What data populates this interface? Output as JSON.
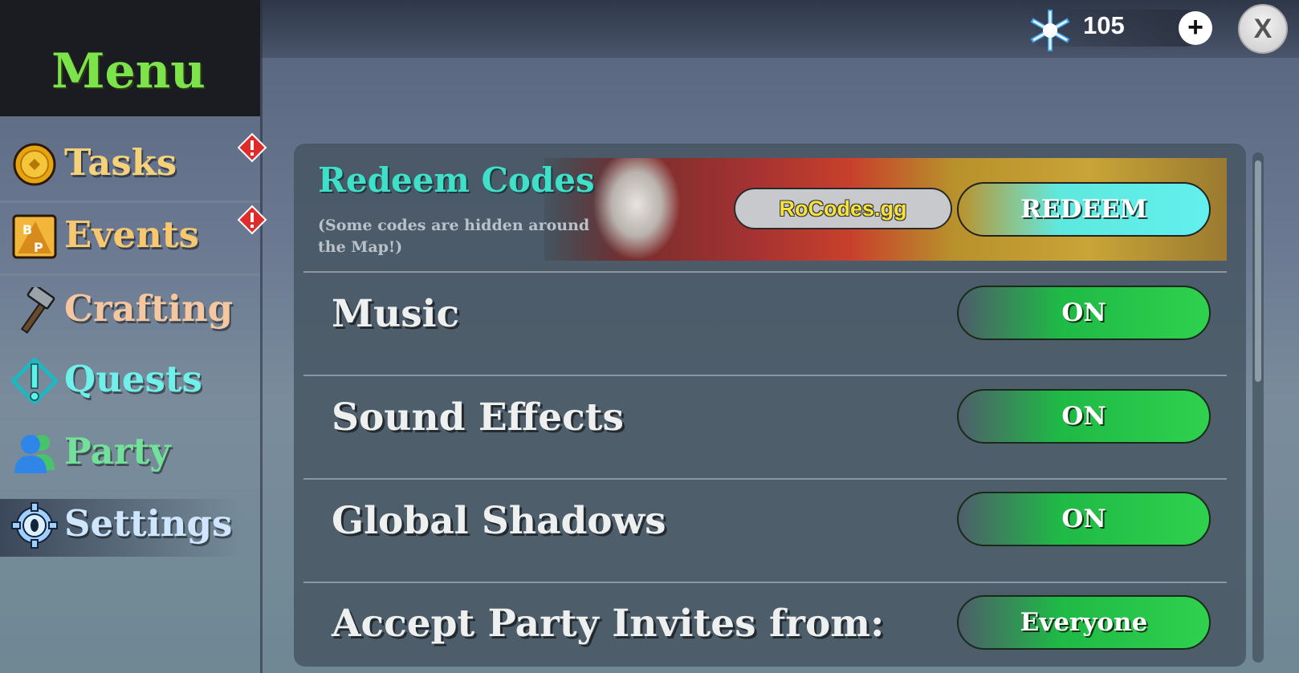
{
  "topbar": {
    "currency": {
      "icon": "snowflake-gem-icon",
      "value": "105",
      "add_label": "+"
    },
    "close_label": "X"
  },
  "sidebar": {
    "title": "Menu",
    "items": [
      {
        "label": "Tasks",
        "icon": "coin-icon",
        "color": "#f5d27a",
        "alert": true
      },
      {
        "label": "Events",
        "icon": "battle-pass-icon",
        "color": "#f7c870",
        "alert": true
      },
      {
        "label": "Crafting",
        "icon": "hammer-icon",
        "color": "#f4c7a0",
        "alert": false
      },
      {
        "label": "Quests",
        "icon": "quest-exclamation-icon",
        "color": "#6ff0e8",
        "alert": false
      },
      {
        "label": "Party",
        "icon": "party-people-icon",
        "color": "#72e29a",
        "alert": false
      },
      {
        "label": "Settings",
        "icon": "gear-icon",
        "color": "#cfe6ff",
        "alert": false,
        "selected": true
      }
    ]
  },
  "settings": {
    "redeem": {
      "title": "Redeem Codes",
      "subtitle": "(Some codes are hidden around the Map!)",
      "input_value": "RoCodes.gg",
      "button_label": "REDEEM"
    },
    "rows": [
      {
        "label": "Music",
        "value": "ON"
      },
      {
        "label": "Sound Effects",
        "value": "ON"
      },
      {
        "label": "Global Shadows",
        "value": "ON"
      },
      {
        "label": "Accept Party Invites from:",
        "value": "Everyone"
      }
    ]
  },
  "colors": {
    "menu_title": "#7de34b",
    "toggle_on": "#2fd14e",
    "redeem_button": "#5ee8de",
    "redeem_title": "#3fe0c8"
  }
}
